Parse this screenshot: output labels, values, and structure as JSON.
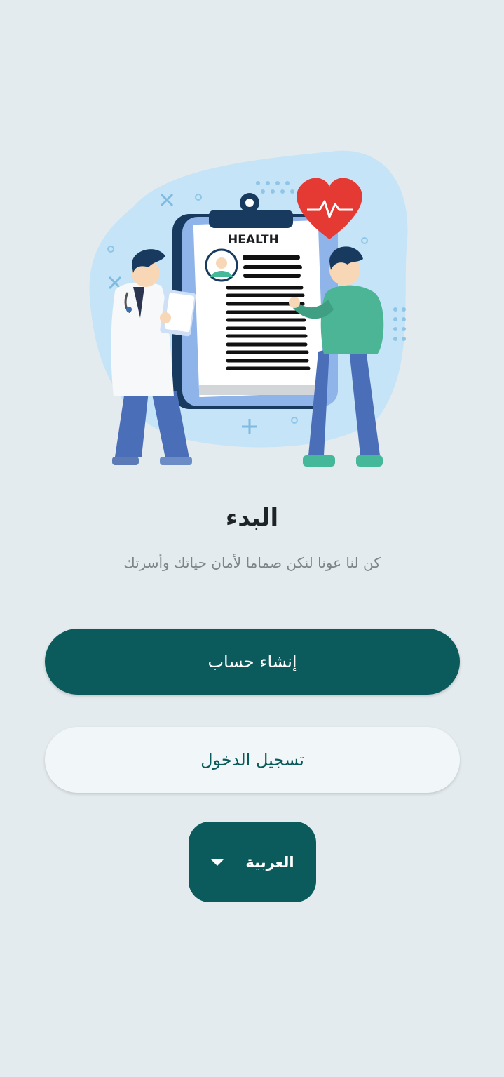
{
  "illustration": {
    "clipboard_heading": "HEALTH",
    "icon": "doctor-patient-health-record-illustration"
  },
  "screen": {
    "title": "البدء",
    "subtitle": "كن لنا عونا لنكن صماما لأمان حياتك وأسرتك"
  },
  "actions": {
    "create_account_label": "إنشاء حساب",
    "login_label": "تسجيل الدخول"
  },
  "language_selector": {
    "selected": "العربية",
    "icon": "caret-down-icon"
  },
  "colors": {
    "primary": "#0b5b5c",
    "background": "#e4ebee",
    "secondary_button": "#f1f7f8"
  }
}
